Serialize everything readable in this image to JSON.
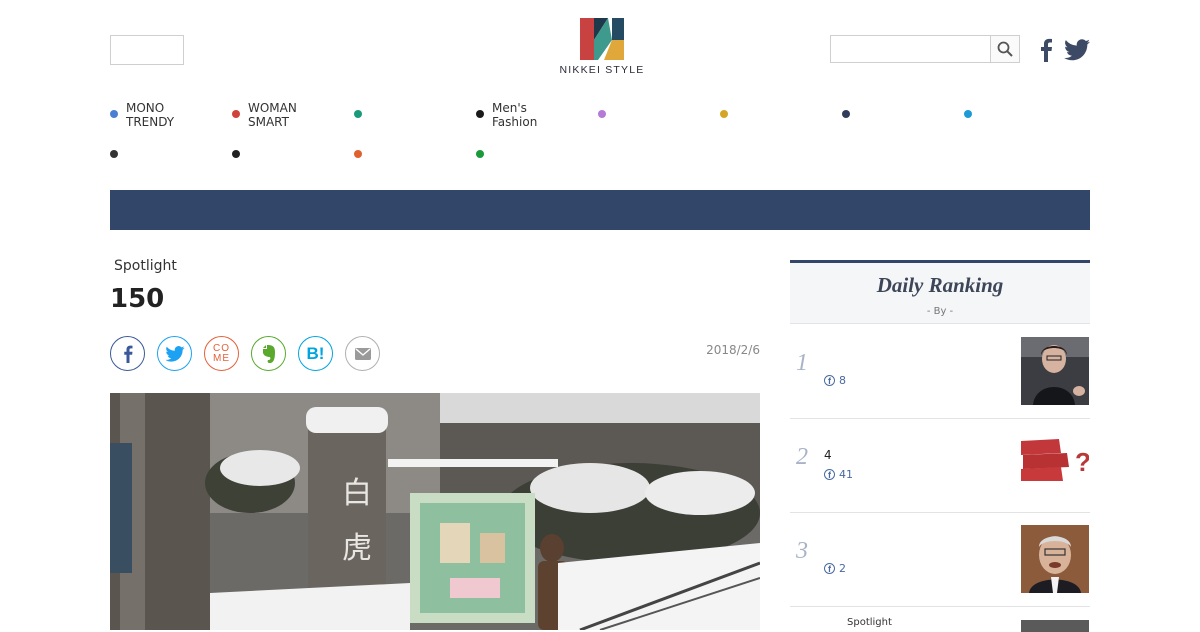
{
  "header": {
    "logo_text": "NIKKEI STYLE",
    "search_placeholder": "",
    "icons": [
      "search-icon",
      "facebook-icon",
      "twitter-icon"
    ]
  },
  "nav": {
    "items": [
      {
        "label": "MONO\nTRENDY",
        "color": "#4a7fd4"
      },
      {
        "label": "WOMAN\nSMART",
        "color": "#d0423a"
      },
      {
        "label": "",
        "color": "#1a9a7a"
      },
      {
        "label": "Men's\nFashion",
        "color": "#1a1a1a"
      },
      {
        "label": "",
        "color": "#b57ad6"
      },
      {
        "label": "",
        "color": "#d4a626"
      },
      {
        "label": "",
        "color": "#2f3c5c"
      },
      {
        "label": "",
        "color": "#1e9ad6"
      },
      {
        "label": "",
        "color": "#333333"
      },
      {
        "label": "",
        "color": "#222222"
      },
      {
        "label": "",
        "color": "#e0602e"
      },
      {
        "label": "",
        "color": "#1a9a3a"
      }
    ]
  },
  "banner": {
    "color": "#324669"
  },
  "article": {
    "category": "Spotlight",
    "title": "150",
    "date": "2018/2/6",
    "share_buttons": [
      {
        "name": "facebook",
        "glyph": "f",
        "color": "#3b5998"
      },
      {
        "name": "twitter",
        "glyph": "",
        "color": "#1da1f2"
      },
      {
        "name": "comment",
        "glyph": "CO\nME",
        "color": "#e5603a"
      },
      {
        "name": "evernote",
        "glyph": "",
        "color": "#5aa92e"
      },
      {
        "name": "hatena",
        "glyph": "B!",
        "color": "#00a4de"
      },
      {
        "name": "mail",
        "glyph": "",
        "color": "#9a9a9a"
      }
    ]
  },
  "ranking": {
    "title": "Daily Ranking",
    "subtitle": "- By  -",
    "items": [
      {
        "rank": "1",
        "text": "",
        "fb_count": "8"
      },
      {
        "rank": "2",
        "text": "4",
        "fb_count": "41"
      },
      {
        "rank": "3",
        "text": "",
        "fb_count": "2"
      }
    ],
    "extra_label": "Spotlight"
  }
}
